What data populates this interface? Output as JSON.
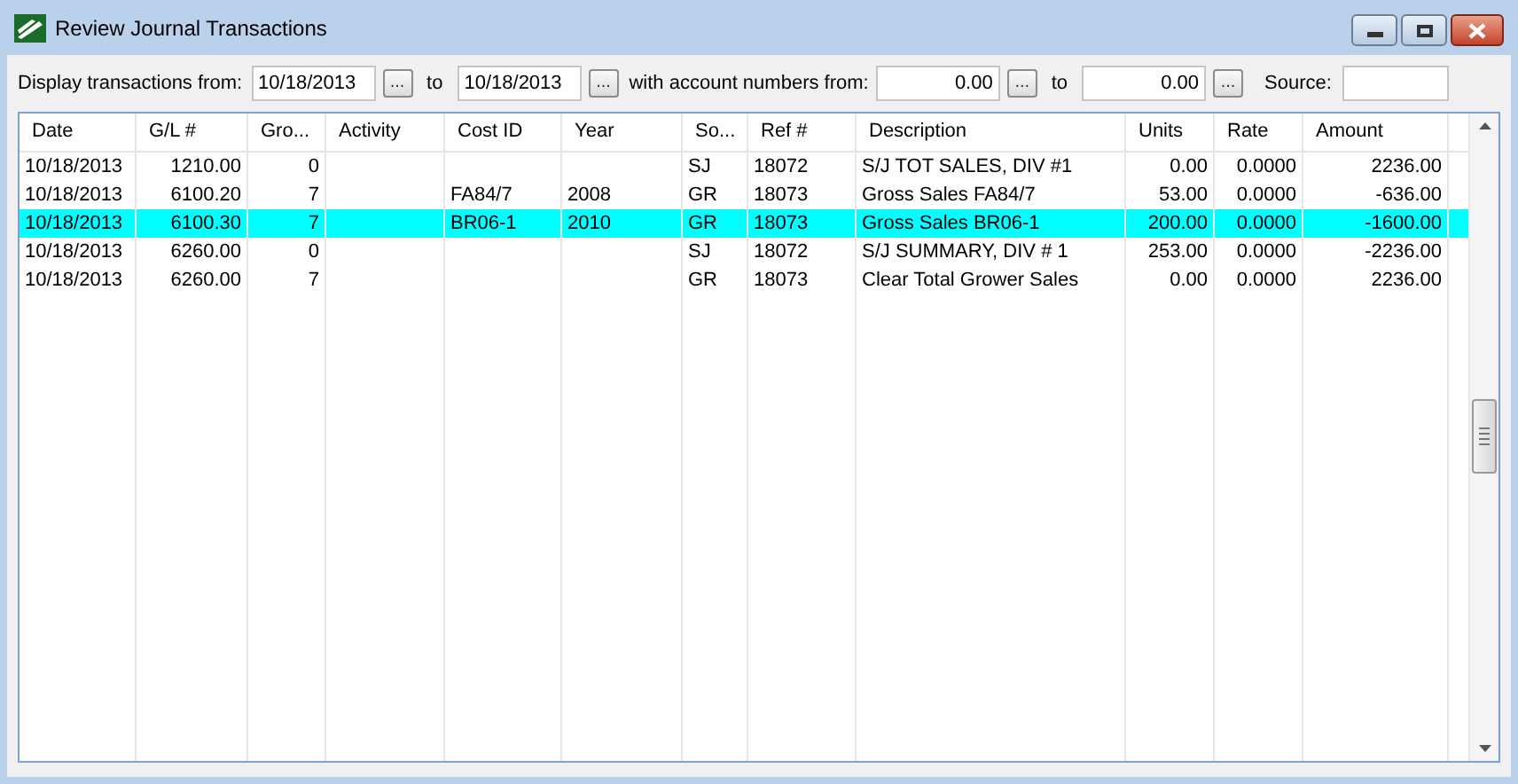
{
  "window": {
    "title": "Review Journal Transactions"
  },
  "filters": {
    "from_label": "Display transactions from:",
    "from_date": "10/18/2013",
    "to_label": "to",
    "to_date": "10/18/2013",
    "accounts_label": "with account numbers from:",
    "account_from": "0.00",
    "account_to_label": "to",
    "account_to": "0.00",
    "source_label": "Source:",
    "browse_button": "..."
  },
  "table": {
    "columns": [
      "Date",
      "G/L #",
      "Gro...",
      "Activity",
      "Cost ID",
      "Year",
      "So...",
      "Ref #",
      "Description",
      "Units",
      "Rate",
      "Amount"
    ],
    "rows": [
      {
        "selected": false,
        "cells": [
          "10/18/2013",
          "1210.00",
          "0",
          "",
          "",
          "",
          "SJ",
          "18072",
          "S/J TOT SALES, DIV #1",
          "0.00",
          "0.0000",
          "2236.00"
        ]
      },
      {
        "selected": false,
        "cells": [
          "10/18/2013",
          "6100.20",
          "7",
          "",
          "FA84/7",
          "2008",
          "GR",
          "18073",
          "Gross Sales FA84/7",
          "53.00",
          "0.0000",
          "-636.00"
        ]
      },
      {
        "selected": true,
        "cells": [
          "10/18/2013",
          "6100.30",
          "7",
          "",
          "BR06-1",
          "2010",
          "GR",
          "18073",
          "Gross Sales BR06-1",
          "200.00",
          "0.0000",
          "-1600.00"
        ]
      },
      {
        "selected": false,
        "cells": [
          "10/18/2013",
          "6260.00",
          "0",
          "",
          "",
          "",
          "SJ",
          "18072",
          "S/J SUMMARY, DIV # 1",
          "253.00",
          "0.0000",
          "-2236.00"
        ]
      },
      {
        "selected": false,
        "cells": [
          "10/18/2013",
          "6260.00",
          "7",
          "",
          "",
          "",
          "GR",
          "18073",
          "Clear Total Grower Sales",
          "0.00",
          "0.0000",
          "2236.00"
        ]
      }
    ]
  }
}
